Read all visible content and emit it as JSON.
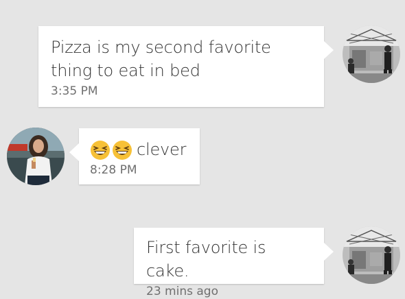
{
  "messages": [
    {
      "sender": "self",
      "text": "Pizza is my second favorite thing to eat in bed",
      "time": "3:35 PM",
      "avatar_icon": "avatar-photo-bw"
    },
    {
      "sender": "other",
      "emoji": [
        "grinning-squinting-face",
        "grinning-squinting-face"
      ],
      "text": "clever",
      "time": "8:28 PM",
      "avatar_icon": "avatar-photo-woman"
    },
    {
      "sender": "self",
      "text": "First favorite is cake.",
      "time": "23 mins ago",
      "avatar_icon": "avatar-photo-bw"
    }
  ],
  "colors": {
    "background": "#e5e5e5",
    "bubble": "#ffffff",
    "text": "#333333",
    "timestamp": "#6f6f6f",
    "emoji_yellow": "#f7c137"
  }
}
